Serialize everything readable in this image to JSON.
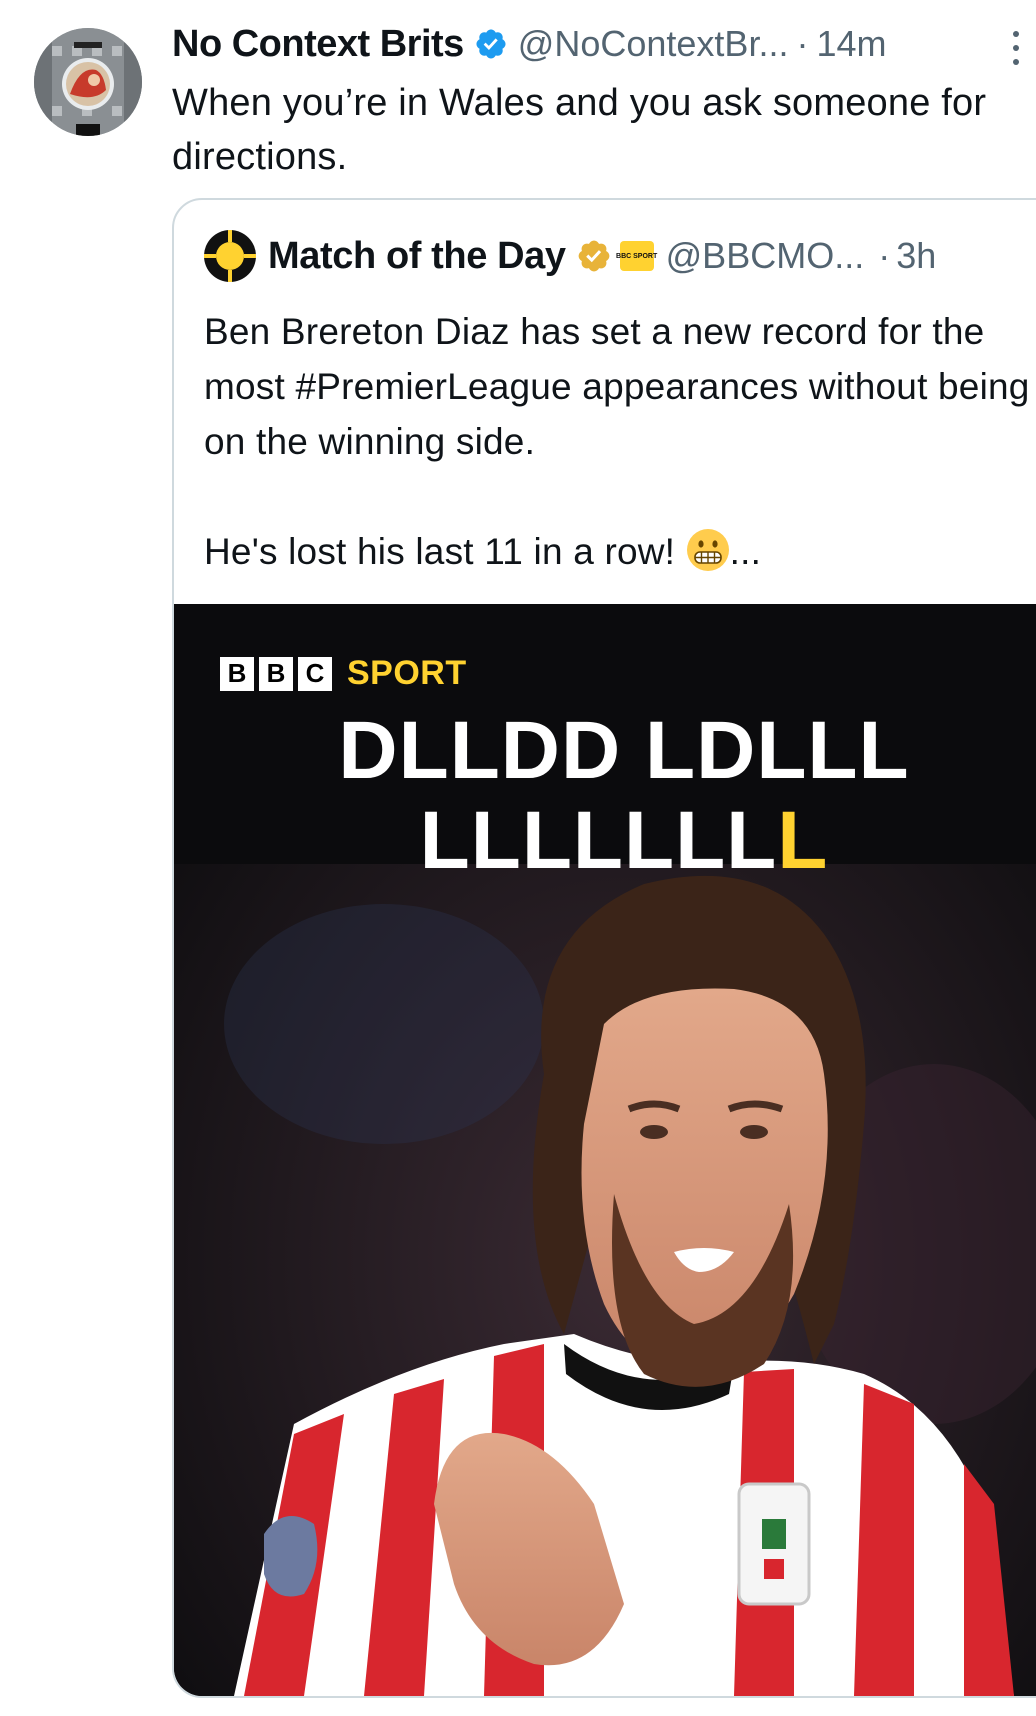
{
  "tweet": {
    "author_name": "No Context Brits",
    "handle": "@NoContextBr...",
    "separator": "·",
    "time": "14m",
    "text": "When you’re in Wales and you ask someone for directions."
  },
  "quoted": {
    "author_name": "Match of the Day",
    "affiliate_badge_text": "BBC SPORT",
    "handle": "@BBCMO...",
    "separator": "·",
    "time": "3h",
    "text_p1": "Ben Brereton Diaz has set a new record for the most #PremierLeague appearances without being on the winning side.",
    "text_p2": "He's lost his last 11 in a row!",
    "text_ellipsis": "...",
    "media": {
      "brand_letters": [
        "B",
        "B",
        "C"
      ],
      "brand_word": "SPORT",
      "headline_line1": "DLLDD LDLLL",
      "headline_line2_main": "LLLLLLL",
      "headline_line2_accent": "L"
    }
  },
  "colors": {
    "verified_blue": "#1d9bf0",
    "gold_badge": "#e8b339",
    "bbc_yellow": "#ffd230",
    "secondary_text": "#536471",
    "border": "#cfd9de"
  },
  "icons": [
    "verified-badge-icon",
    "more-options-icon",
    "gold-verified-badge-icon",
    "grimacing-face-emoji"
  ]
}
